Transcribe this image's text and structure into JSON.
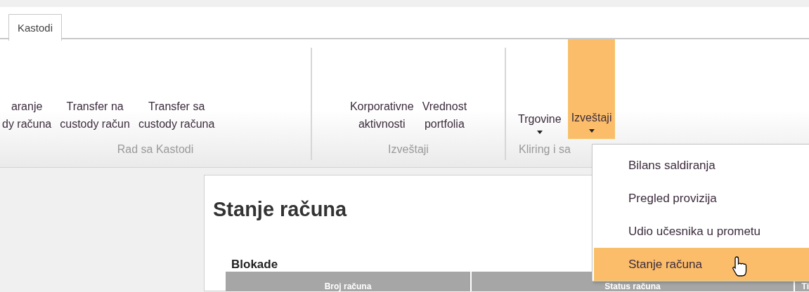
{
  "tabs": [
    {
      "label": "Kastodi",
      "selected": true
    }
  ],
  "ribbon_groups": [
    {
      "label": "Rad sa Kastodi",
      "buttons": [
        {
          "label": "aranje\ndy računa",
          "dropdown": false,
          "selected": false
        },
        {
          "label": "Transfer na\ncustody račun",
          "dropdown": false,
          "selected": false
        },
        {
          "label": "Transfer sa\ncustody računa",
          "dropdown": false,
          "selected": false
        }
      ]
    },
    {
      "label": "Izveštaji",
      "buttons": [
        {
          "label": "Korporativne\naktivnosti",
          "dropdown": false,
          "selected": false
        },
        {
          "label": "Vrednost\nportfolia",
          "dropdown": false,
          "selected": false
        }
      ]
    },
    {
      "label": "Kliring i sa",
      "buttons": [
        {
          "label": "Trgovine",
          "dropdown": true,
          "selected": false
        },
        {
          "label": "Izveštaji",
          "dropdown": true,
          "selected": true
        }
      ]
    }
  ],
  "dropdown_menu": [
    {
      "label": "Bilans saldiranja",
      "selected": false
    },
    {
      "label": "Pregled provizija",
      "selected": false
    },
    {
      "label": "Udio učesnika u prometu",
      "selected": false
    },
    {
      "label": "Stanje računa",
      "selected": true
    }
  ],
  "page": {
    "title": "Stanje računa",
    "section": "Blokade",
    "table": {
      "columns": [
        "Broj računa",
        "Status računa",
        "Ti"
      ]
    }
  }
}
